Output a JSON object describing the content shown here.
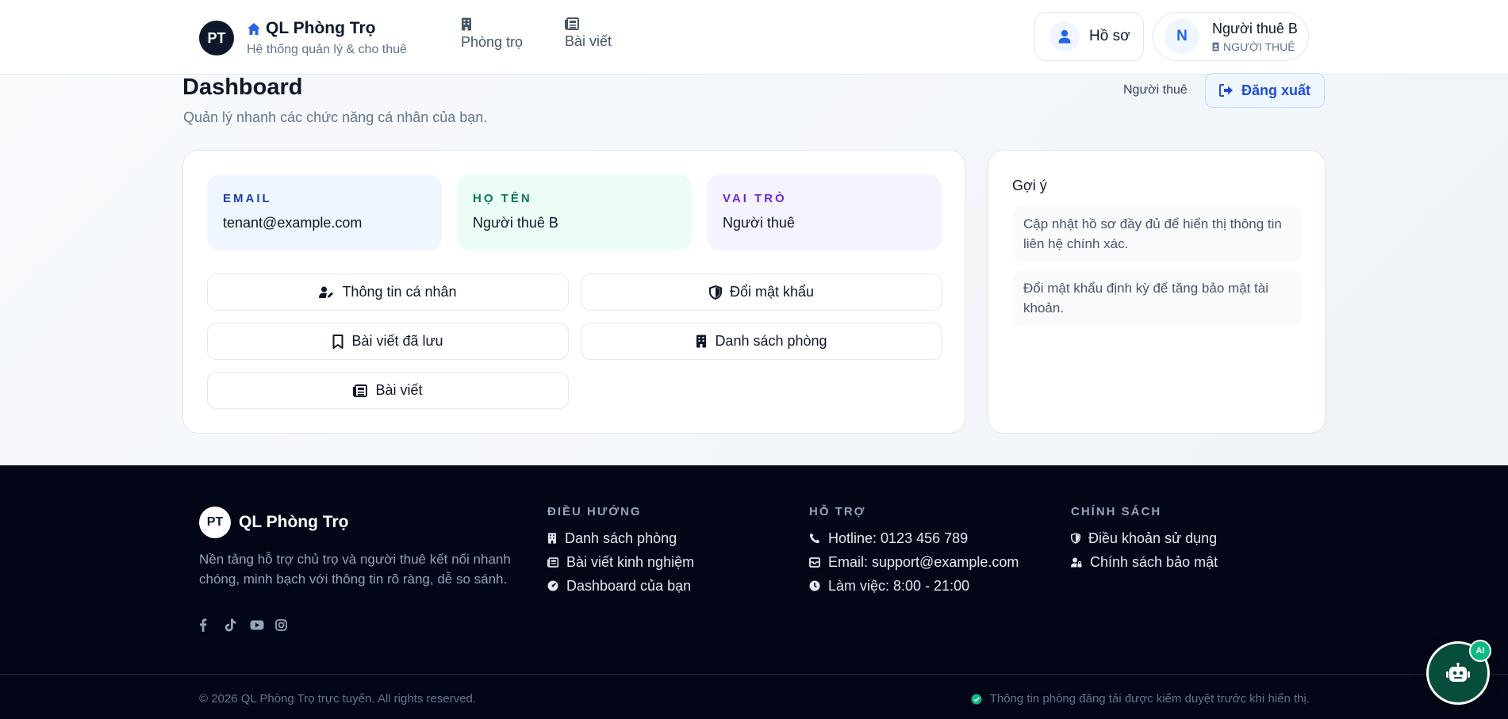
{
  "colors": {
    "accent": "#2563eb",
    "dark": "#0f172a",
    "footer_bg": "#020617",
    "success": "#10b981"
  },
  "header": {
    "brand_initials": "PT",
    "brand_title": "QL Phòng Trọ",
    "brand_subtitle": "Hệ thống quản lý & cho thuê",
    "nav": [
      {
        "label": "Phòng trọ",
        "icon": "building-icon"
      },
      {
        "label": "Bài viết",
        "icon": "newspaper-icon"
      }
    ],
    "profile_label": "Hồ sơ",
    "user": {
      "avatar_letter": "N",
      "name": "Người thuê B",
      "role": "NGƯỜI THUÊ"
    }
  },
  "page": {
    "title": "Dashboard",
    "subtitle": "Quản lý nhanh các chức năng cá nhân của bạn.",
    "role_label": "Người thuê",
    "logout_label": "Đăng xuất"
  },
  "info": {
    "email": {
      "label": "EMAIL",
      "value": "tenant@example.com"
    },
    "name": {
      "label": "HỌ TÊN",
      "value": "Người thuê B"
    },
    "role": {
      "label": "VAI TRÒ",
      "value": "Người thuê"
    }
  },
  "actions": [
    {
      "label": "Thông tin cá nhân",
      "icon": "user-edit-icon"
    },
    {
      "label": "Đổi mật khẩu",
      "icon": "shield-icon"
    },
    {
      "label": "Bài viết đã lưu",
      "icon": "bookmark-icon"
    },
    {
      "label": "Danh sách phòng",
      "icon": "building-icon"
    },
    {
      "label": "Bài viết",
      "icon": "newspaper-icon"
    }
  ],
  "tips": {
    "title": "Gợi ý",
    "items": [
      "Cập nhật hồ sơ đầy đủ để hiển thị thông tin liên hệ chính xác.",
      "Đổi mật khẩu định kỳ để tăng bảo mật tài khoản."
    ]
  },
  "footer": {
    "brand_initials": "PT",
    "brand_name": "QL Phòng Trọ",
    "description": "Nền tảng hỗ trợ chủ trọ và người thuê kết nối nhanh chóng, minh bạch với thông tin rõ ràng, dễ so sánh.",
    "social": [
      "facebook-icon",
      "tiktok-icon",
      "youtube-icon",
      "instagram-icon"
    ],
    "columns": [
      {
        "title": "ĐIỀU HƯỚNG",
        "items": [
          "Danh sách phòng",
          "Bài viết kinh nghiệm",
          "Dashboard của bạn"
        ]
      },
      {
        "title": "HỖ TRỢ",
        "items": [
          "Hotline: 0123 456 789",
          "Email: support@example.com",
          "Làm việc: 8:00 - 21:00"
        ]
      },
      {
        "title": "CHÍNH SÁCH",
        "items": [
          "Điều khoản sử dụng",
          "Chính sách bảo mật"
        ]
      }
    ],
    "copyright": "© 2026 QL Phòng Trọ trực tuyến. All rights reserved.",
    "note": "Thông tin phòng đăng tải được kiểm duyệt trước khi hiển thị."
  },
  "ai_badge": "AI"
}
